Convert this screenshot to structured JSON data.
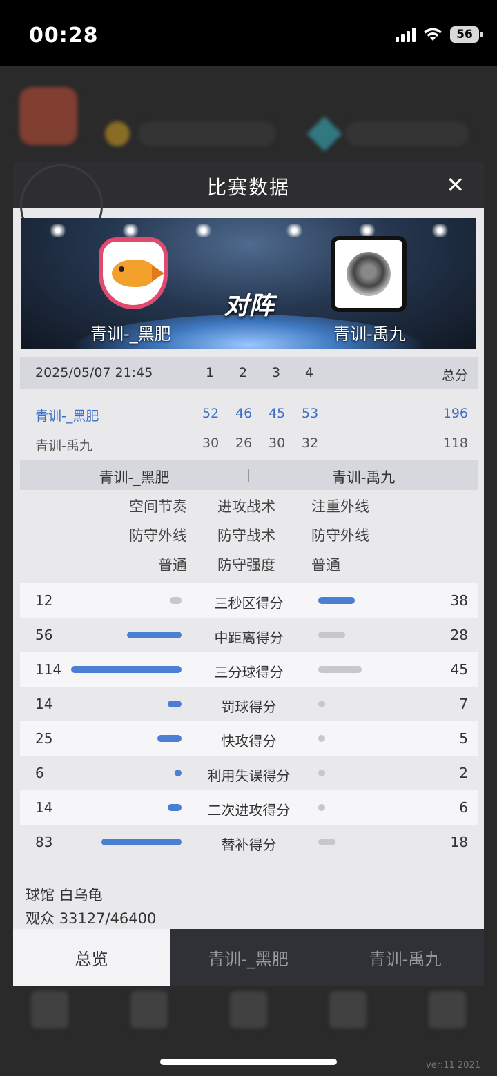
{
  "status_bar": {
    "time": "00:28",
    "battery": "56"
  },
  "background": {
    "version": "ver:11  2021"
  },
  "modal": {
    "title": "比赛数据",
    "close_label": "✕",
    "matchup": {
      "vs_text": "对阵",
      "home_team": "青训-_黑肥",
      "away_team": "青训-禹九"
    },
    "score_table": {
      "date": "2025/05/07 21:45",
      "quarters": [
        "1",
        "2",
        "3",
        "4"
      ],
      "total_label": "总分",
      "home": {
        "name": "青训-_黑肥",
        "q": [
          "52",
          "46",
          "45",
          "53"
        ],
        "total": "196"
      },
      "away": {
        "name": "青训-禹九",
        "q": [
          "30",
          "26",
          "30",
          "32"
        ],
        "total": "118"
      }
    },
    "tactics": {
      "home_team": "青训-_黑肥",
      "away_team": "青训-禹九",
      "rows": [
        {
          "home": "空间节奏",
          "label": "进攻战术",
          "away": "注重外线"
        },
        {
          "home": "防守外线",
          "label": "防守战术",
          "away": "防守外线"
        },
        {
          "home": "普通",
          "label": "防守强度",
          "away": "普通"
        }
      ]
    },
    "stats": [
      {
        "label": "三秒区得分",
        "home": "12",
        "away": "38"
      },
      {
        "label": "中距离得分",
        "home": "56",
        "away": "28"
      },
      {
        "label": "三分球得分",
        "home": "114",
        "away": "45"
      },
      {
        "label": "罚球得分",
        "home": "14",
        "away": "7"
      },
      {
        "label": "快攻得分",
        "home": "25",
        "away": "5"
      },
      {
        "label": "利用失误得分",
        "home": "6",
        "away": "2"
      },
      {
        "label": "二次进攻得分",
        "home": "14",
        "away": "6"
      },
      {
        "label": "替补得分",
        "home": "83",
        "away": "18"
      }
    ],
    "venue": {
      "arena_label": "球馆",
      "arena": "白乌龟",
      "attendance_label": "观众",
      "attendance": "33127/46400"
    },
    "tabs": [
      "总览",
      "青训-_黑肥",
      "青训-禹九"
    ],
    "colors": {
      "accent_blue": "#4a7fd4",
      "bar_gray": "#c8c8cc",
      "home_text": "#3a6fc4"
    }
  }
}
